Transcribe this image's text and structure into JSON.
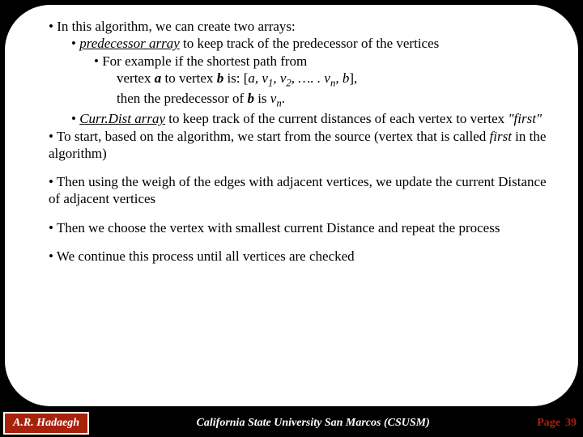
{
  "slide": {
    "b1": "• In this algorithm, we can create two arrays:",
    "b2_pre": "• ",
    "b2_term": "predecessor array",
    "b2_post": " to keep track of the predecessor of the vertices",
    "b3": "• For example if the shortest path from",
    "b4_a": "vertex ",
    "b4_bold_a": "a",
    "b4_b": " to vertex ",
    "b4_bold_b": "b",
    "b4_c": " is:   [",
    "b4_it_a": "a, v",
    "b4_sub1": "1",
    "b4_it_sep1": ", v",
    "b4_sub2": "2",
    "b4_it_dots": ", …. . v",
    "b4_subn": "n",
    "b4_it_end": ",  b",
    "b4_close": "],",
    "b5_a": "then the predecessor of ",
    "b5_bold_b": "b",
    "b5_b": " is ",
    "b5_it_v": "v",
    "b5_subn": "n",
    "b5_dot": ".",
    "b6_pre": "• ",
    "b6_term": "Curr.Dist array",
    "b6_post_a": " to keep track of the current distances of each vertex to vertex ",
    "b6_quote": "\"first\"",
    "b7_a": "• To start, based on the algorithm, we start from the source (vertex that is called ",
    "b7_first": "first",
    "b7_b": " in the algorithm)",
    "b8": "• Then using the weigh of the edges with adjacent vertices, we update the current Distance of adjacent vertices",
    "b9": "• Then we choose the vertex with smallest current Distance and repeat the process",
    "b10": "• We continue this process until all vertices are checked"
  },
  "footer": {
    "author": "A.R. Hadaegh",
    "university": "California State University San Marcos (CSUSM)",
    "page_label": "Page",
    "page_number": "39"
  }
}
